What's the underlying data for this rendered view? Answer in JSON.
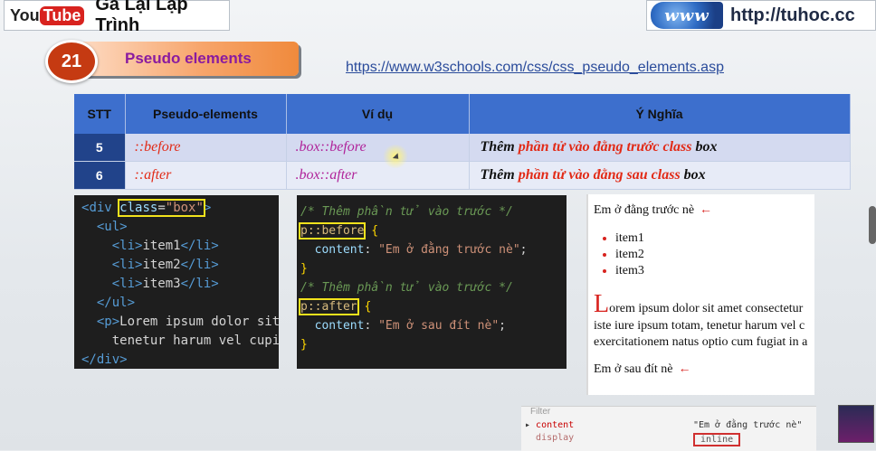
{
  "header": {
    "yt_you": "You",
    "yt_tube": "Tube",
    "channel_name": "Gà Lại Lập Trình",
    "www_logo": "www",
    "site_url": "http://tuhoc.cc"
  },
  "lesson": {
    "number": "21",
    "title": "Pseudo elements",
    "reference_link": "https://www.w3schools.com/css/css_pseudo_elements.asp"
  },
  "table": {
    "headers": [
      "STT",
      "Pseudo-elements",
      "Ví dụ",
      "Ý Nghĩa"
    ],
    "rows": [
      {
        "stt": "5",
        "pseudo": "::before",
        "example": ".box::before",
        "meaning_prefix": "Thêm ",
        "meaning_highlight": "phần tử vào đằng trước class",
        "meaning_suffix": " box"
      },
      {
        "stt": "6",
        "pseudo": "::after",
        "example": ".box::after",
        "meaning_prefix": "Thêm ",
        "meaning_highlight": "phần tử vào đằng sau class",
        "meaning_suffix": " box"
      }
    ]
  },
  "html_code": {
    "l1_open": "<",
    "l1_tag": "div",
    "l1_attr": "class",
    "l1_eq": "=",
    "l1_val": "\"box\"",
    "l1_close": ">",
    "ul_open": "<ul>",
    "li_open": "<li>",
    "li_close": "</li>",
    "item1": "item1",
    "item2": "item2",
    "item3": "item3",
    "ul_close": "</ul>",
    "p_open": "<p>",
    "p_text1": "Lorem ipsum dolor sit",
    "p_text2": "tenetur harum vel cupi",
    "div_close": "</div>"
  },
  "css_code": {
    "comment_before": "/* Thêm phần tử vào trước */",
    "selector_before": "p::before",
    "comment_after": "/* Thêm phần tử vào trước */",
    "selector_after": "p::after",
    "open_brace": "{",
    "close_brace": "}",
    "prop": "content",
    "colon": ":",
    "value_before": "\"Em ở đằng trước nè\"",
    "value_after": "\"Em ở sau đít nè\"",
    "semi": ";"
  },
  "preview": {
    "before_text": "Em ở đằng trước nè",
    "arrow": "←",
    "items": [
      "item1",
      "item2",
      "item3"
    ],
    "dropcap": "L",
    "para_line1": "orem ipsum dolor sit amet consectetur",
    "para_line2": "iste iure ipsum totam, tenetur harum vel c",
    "para_line3": "exercitationem natus optio cum fugiat in a",
    "after_text": "Em ở sau đít nè"
  },
  "devtools": {
    "filter_label": "Filter",
    "row1_key": "content",
    "row1_val": "\"Em ở đằng trước nè\"",
    "row2_key": "display",
    "row2_val": "inline"
  },
  "colors": {
    "table_header": "#3d6fcd",
    "stt_cell": "#21438a",
    "highlight_red": "#e22a16",
    "title_purple": "#8a1ba0",
    "code_highlight": "#f2e21c"
  }
}
